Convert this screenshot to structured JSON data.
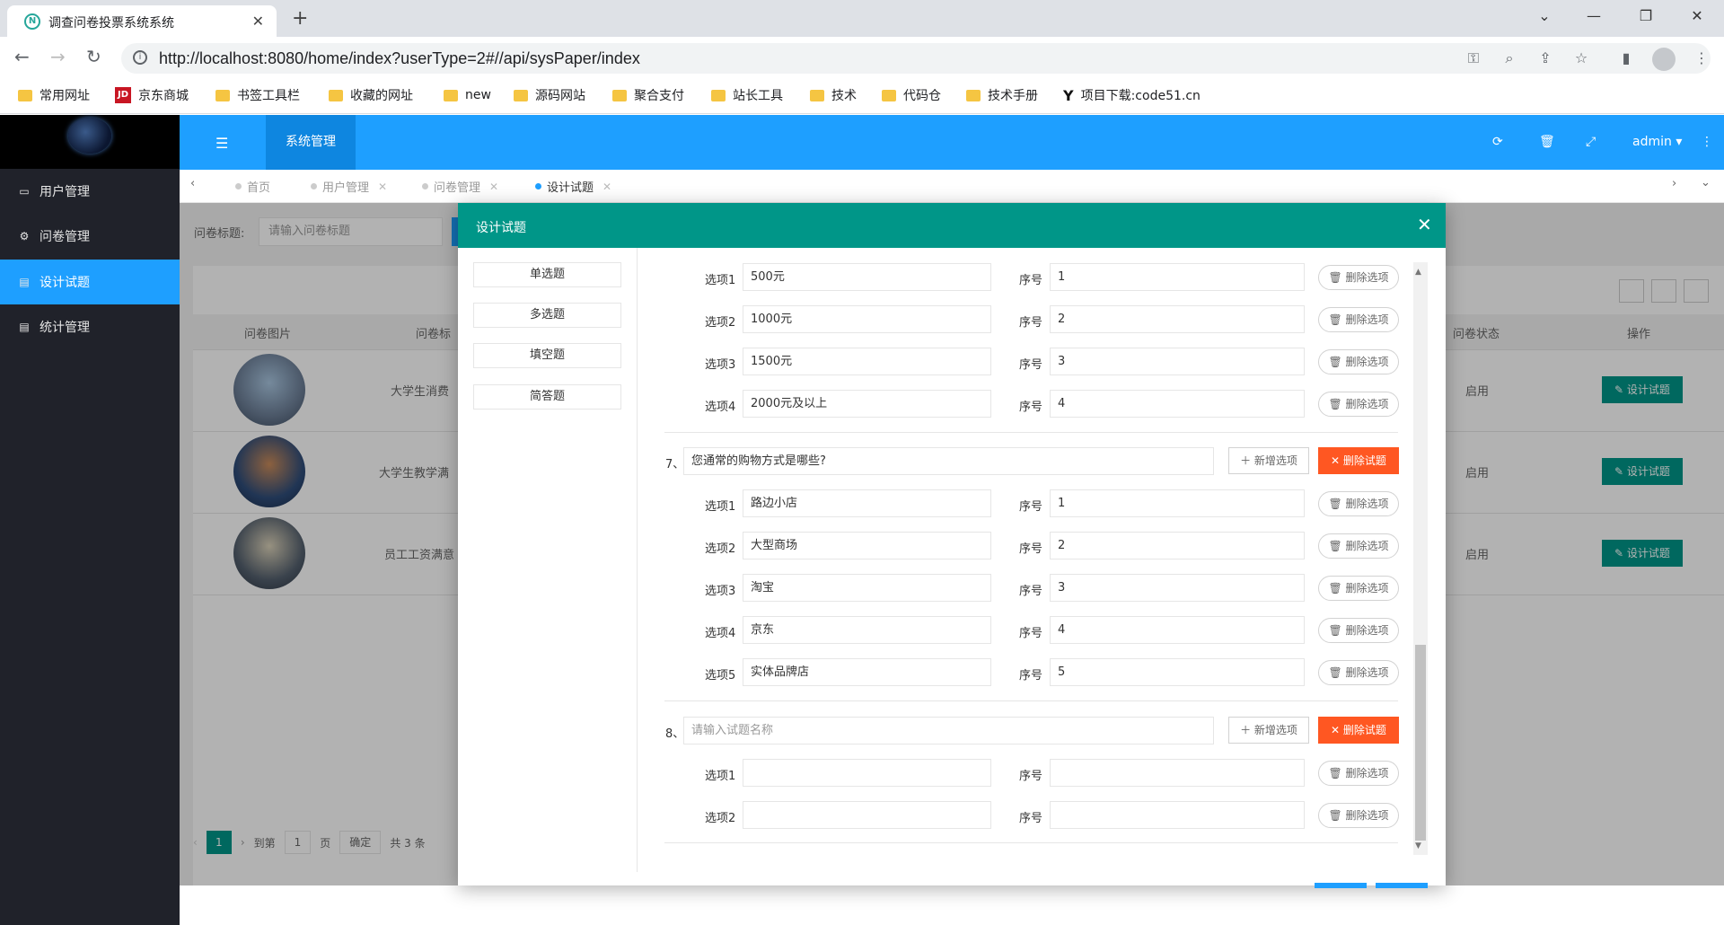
{
  "browser": {
    "tab_title": "调查问卷投票系统系统",
    "url": "http://localhost:8080/home/index?userType=2#//api/sysPaper/index",
    "bookmarks": [
      "常用网址",
      "京东商城",
      "书签工具栏",
      "收藏的网址",
      "new",
      "源码网站",
      "聚合支付",
      "站长工具",
      "技术",
      "代码仓",
      "技术手册",
      "项目下载:code51.cn"
    ]
  },
  "sidebar": {
    "items": [
      {
        "label": "用户管理",
        "icon": "window-icon"
      },
      {
        "label": "问卷管理",
        "icon": "gears-icon"
      },
      {
        "label": "设计试题",
        "icon": "file-icon"
      },
      {
        "label": "统计管理",
        "icon": "file-icon"
      }
    ],
    "active_index": 2
  },
  "header": {
    "system_tab": "系统管理",
    "user": "admin"
  },
  "page_tabs": [
    "首页",
    "用户管理",
    "问卷管理",
    "设计试题"
  ],
  "search": {
    "label": "问卷标题:",
    "placeholder": "请输入问卷标题"
  },
  "table": {
    "headers": {
      "image": "问卷图片",
      "title": "问卷标",
      "status": "问卷状态",
      "action": "操作"
    },
    "rows": [
      {
        "title": "大学生消费",
        "status": "启用",
        "action": "设计试题"
      },
      {
        "title": "大学生教学满",
        "status": "启用",
        "action": "设计试题"
      },
      {
        "title": "员工工资满意",
        "status": "启用",
        "action": "设计试题"
      }
    ]
  },
  "pager": {
    "current": "1",
    "goto_label": "到第",
    "page_input": "1",
    "page_unit": "页",
    "confirm": "确定",
    "total": "共 3 条"
  },
  "modal": {
    "title": "设计试题",
    "question_types": [
      "单选题",
      "多选题",
      "填空题",
      "简答题"
    ],
    "option_label_prefix": "选项",
    "order_label": "序号",
    "delete_option": "删除选项",
    "add_option": "新增选项",
    "delete_question": "删除试题",
    "question_placeholder": "请输入试题名称",
    "prev_options": [
      {
        "label": "选项1",
        "value": "500元",
        "order": "1"
      },
      {
        "label": "选项2",
        "value": "1000元",
        "order": "2"
      },
      {
        "label": "选项3",
        "value": "1500元",
        "order": "3"
      },
      {
        "label": "选项4",
        "value": "2000元及以上",
        "order": "4"
      }
    ],
    "question7": {
      "number": "7、",
      "title": "您通常的购物方式是哪些?",
      "options": [
        {
          "label": "选项1",
          "value": "路边小店",
          "order": "1"
        },
        {
          "label": "选项2",
          "value": "大型商场",
          "order": "2"
        },
        {
          "label": "选项3",
          "value": "淘宝",
          "order": "3"
        },
        {
          "label": "选项4",
          "value": "京东",
          "order": "4"
        },
        {
          "label": "选项5",
          "value": "实体品牌店",
          "order": "5"
        }
      ]
    },
    "question8": {
      "number": "8、",
      "title": "",
      "options": [
        {
          "label": "选项1",
          "value": "",
          "order": ""
        },
        {
          "label": "选项2",
          "value": "",
          "order": ""
        }
      ]
    }
  }
}
